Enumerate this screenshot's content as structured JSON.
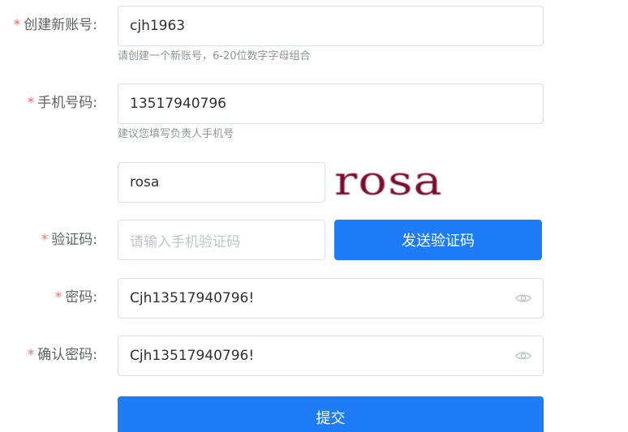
{
  "form": {
    "account": {
      "label": "创建新账号:",
      "value": "cjh1963",
      "hint": "请创建一个新账号，6-20位数字字母组合"
    },
    "phone": {
      "label": "手机号码:",
      "value": "13517940796",
      "hint": "建议您填写负责人手机号"
    },
    "captcha": {
      "value": "rosa",
      "image_text": "rosa"
    },
    "sms_code": {
      "label": "验证码:",
      "placeholder": "请输入手机验证码",
      "send_button": "发送验证码"
    },
    "password": {
      "label": "密码:",
      "value": "Cjh13517940796!"
    },
    "confirm_password": {
      "label": "确认密码:",
      "value": "Cjh13517940796!"
    },
    "submit_label": "提交"
  },
  "theme": {
    "primary": "#1e7cf7",
    "required": "#f56c6c",
    "captcha_color": "#7a0b2c"
  },
  "icons": {
    "password_toggle": "eye-icon"
  }
}
